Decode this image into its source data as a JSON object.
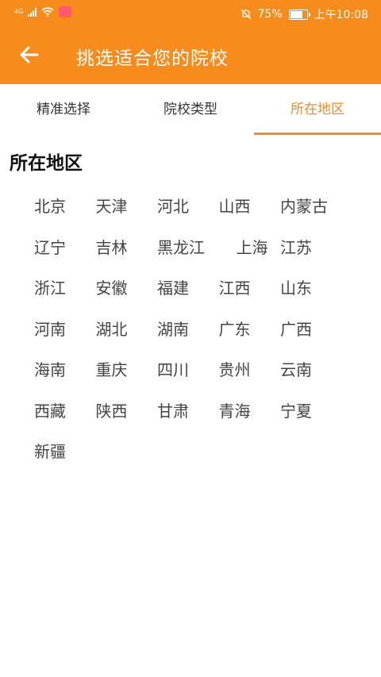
{
  "status_bar": {
    "network": "4G",
    "battery": "75%",
    "battery_level": 0.75,
    "time": "上午10:08"
  },
  "app_bar": {
    "title": "挑选适合您的院校",
    "back_icon": "arrow-left-icon"
  },
  "tabs": [
    {
      "label": "精准选择",
      "active": false
    },
    {
      "label": "院校类型",
      "active": false
    },
    {
      "label": "所在地区",
      "active": true
    }
  ],
  "section_title": "所在地区",
  "regions": [
    [
      "北京",
      "天津",
      "河北",
      "山西",
      "内蒙古"
    ],
    [
      "辽宁",
      "吉林",
      "黑龙江",
      "上海",
      "江苏"
    ],
    [
      "浙江",
      "安徽",
      "福建",
      "江西",
      "山东"
    ],
    [
      "河南",
      "湖北",
      "湖南",
      "广东",
      "广西"
    ],
    [
      "海南",
      "重庆",
      "四川",
      "贵州",
      "云南"
    ],
    [
      "西藏",
      "陕西",
      "甘肃",
      "青海",
      "宁夏"
    ],
    [
      "新疆"
    ]
  ],
  "colors": {
    "accent": "#f78b1c",
    "text": "#444444"
  }
}
